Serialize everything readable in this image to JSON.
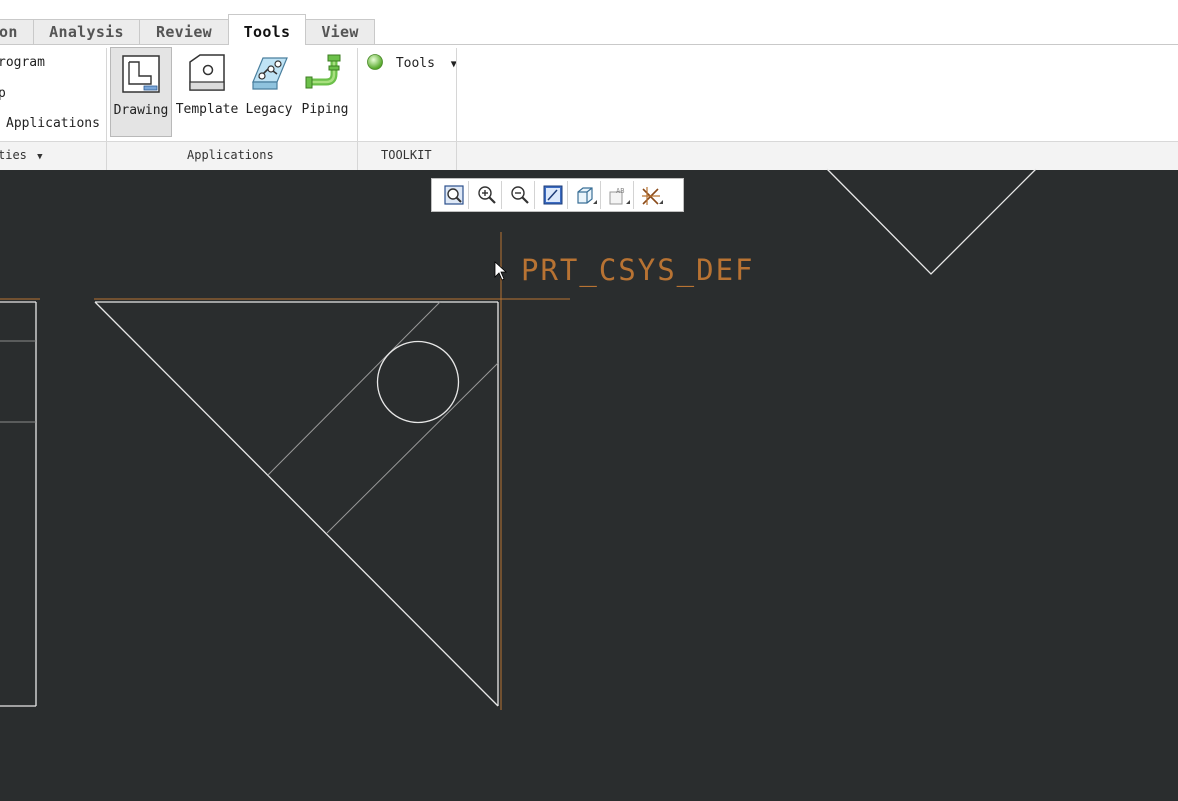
{
  "ribbon": {
    "tabs": [
      {
        "label": "on",
        "active": false
      },
      {
        "label": "Analysis",
        "active": false
      },
      {
        "label": "Review",
        "active": false
      },
      {
        "label": "Tools",
        "active": true
      },
      {
        "label": "View",
        "active": false
      }
    ],
    "left_group": {
      "items": [
        "rogram",
        "p",
        "Applications"
      ],
      "label": "ties"
    },
    "applications": {
      "buttons": [
        {
          "label": "Drawing",
          "icon": "drawing-icon",
          "selected": true
        },
        {
          "label": "Template",
          "icon": "template-icon",
          "selected": false
        },
        {
          "label": "Legacy",
          "icon": "legacy-icon",
          "selected": false
        },
        {
          "label": "Piping",
          "icon": "piping-icon",
          "selected": false
        }
      ],
      "group_label": "Applications"
    },
    "toolkit": {
      "button_label": "Tools",
      "group_label": "TOOLKIT"
    }
  },
  "graphics_toolbar": {
    "buttons": [
      "refit-icon",
      "zoom-in-icon",
      "zoom-out-icon",
      "repaint-icon",
      "view-orientation-icon",
      "annotation-display-icon",
      "datum-display-icon"
    ]
  },
  "canvas": {
    "csys_label": "PRT_CSYS_DEF",
    "colors": {
      "background": "#2a2d2e",
      "geometry": "#e8e8e8",
      "datum": "#b87333"
    }
  }
}
